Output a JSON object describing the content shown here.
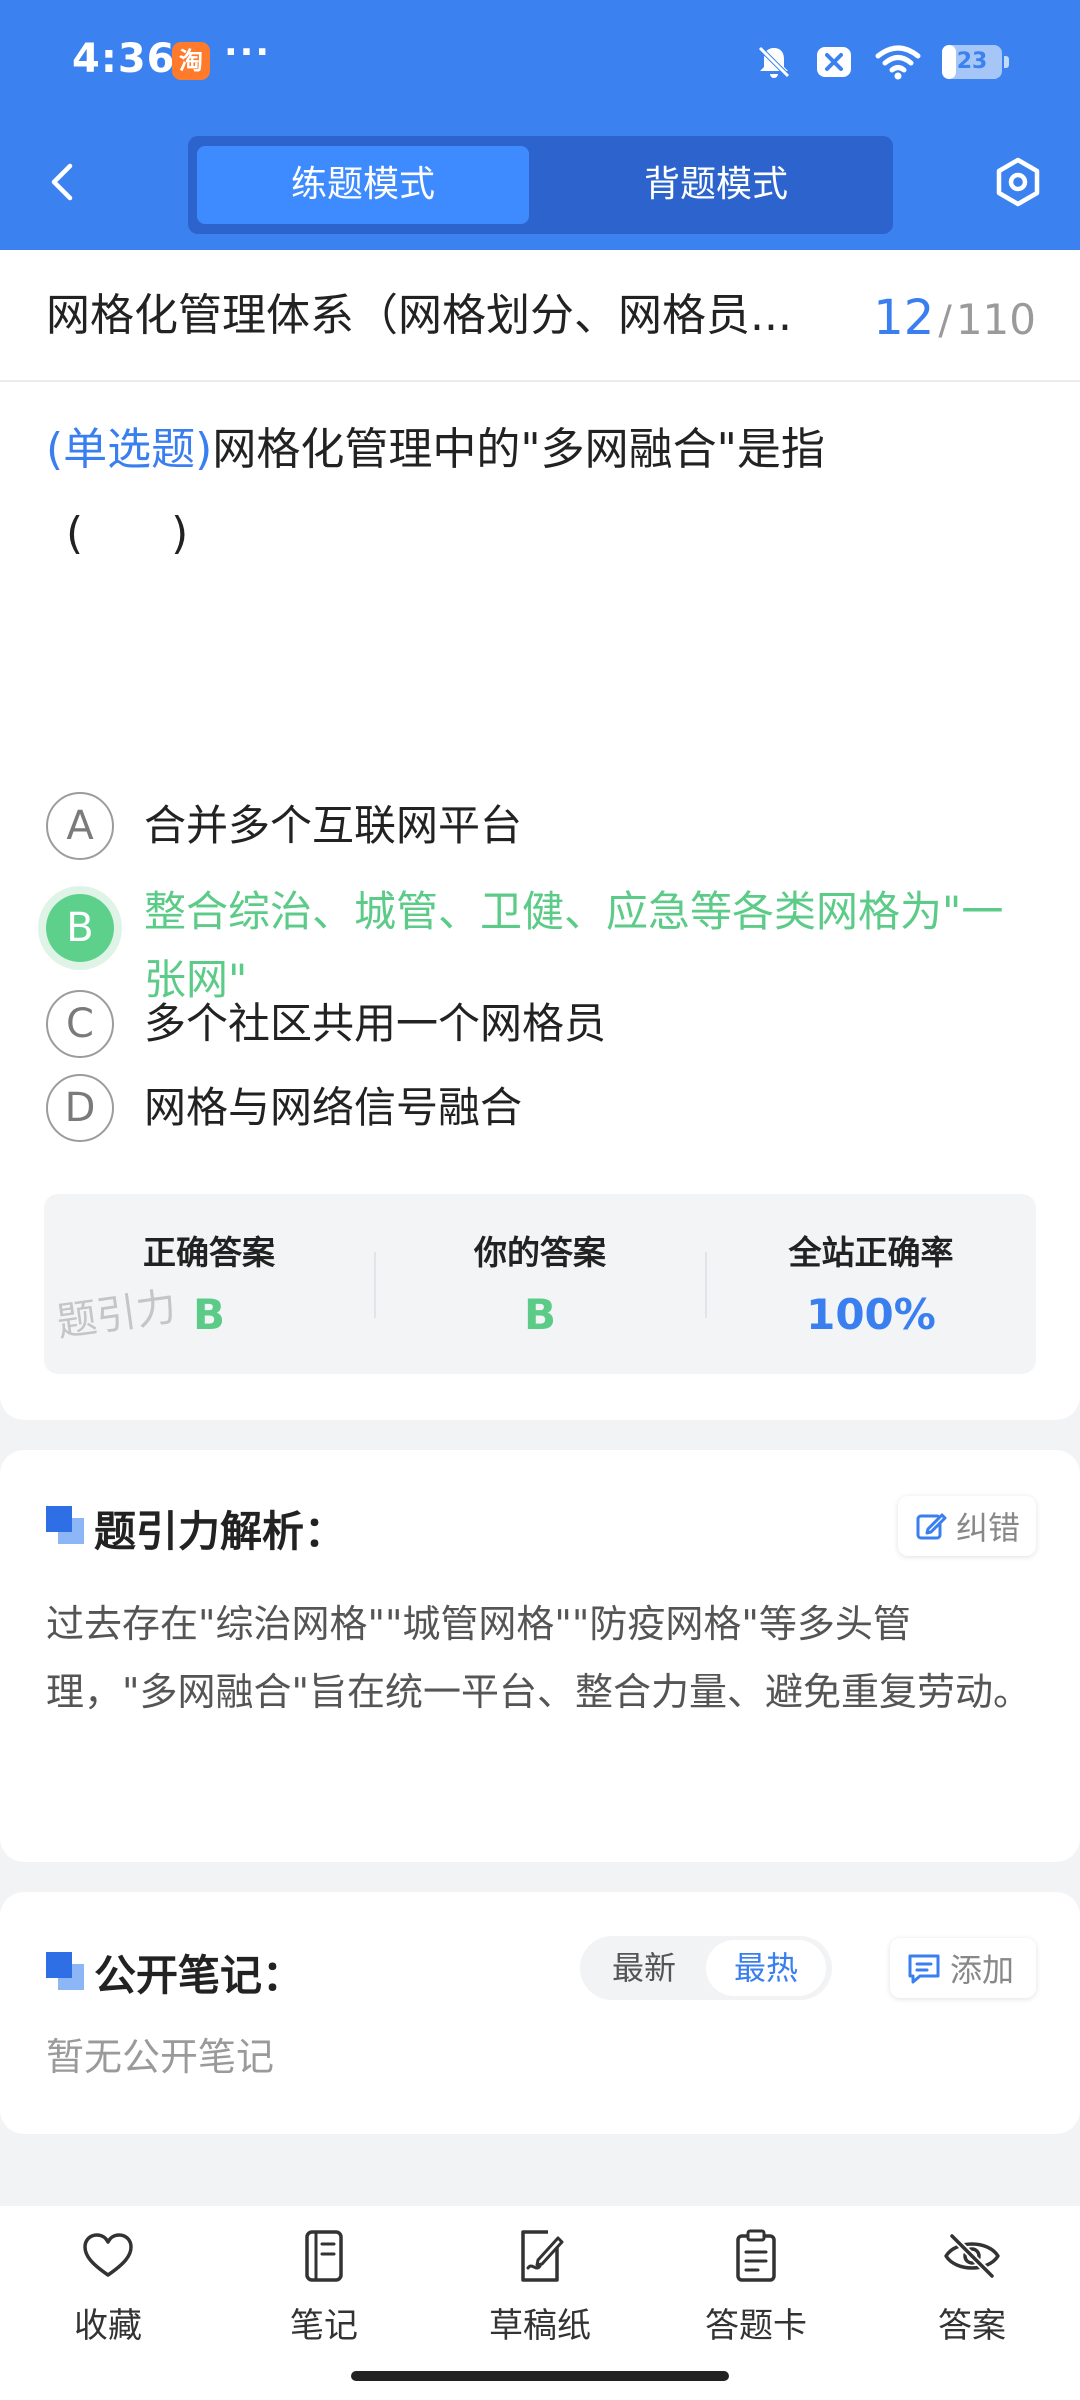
{
  "status_bar": {
    "time": "4:36",
    "app_badge": "淘",
    "more": "···",
    "battery_level": "23",
    "battery_fraction": 0.23
  },
  "header": {
    "modes": [
      "练题模式",
      "背题模式"
    ],
    "active_mode": "练题模式"
  },
  "chapter": {
    "title": "网格化管理体系（网格划分、网格员...",
    "current": "12",
    "separator": "/",
    "total": "110"
  },
  "question": {
    "type": "(单选题)",
    "text": "网格化管理中的\"多网融合\"是指",
    "blank": "(　　)",
    "options": [
      {
        "letter": "A",
        "text": "合并多个互联网平台",
        "state": "normal"
      },
      {
        "letter": "B",
        "text": "整合综治、城管、卫健、应急等各类网格为\"一张网\"",
        "state": "correct"
      },
      {
        "letter": "C",
        "text": "多个社区共用一个网格员",
        "state": "normal"
      },
      {
        "letter": "D",
        "text": "网格与网络信号融合",
        "state": "normal"
      }
    ],
    "result": {
      "correct_label": "正确答案",
      "correct_value": "B",
      "yours_label": "你的答案",
      "yours_value": "B",
      "rate_label": "全站正确率",
      "rate_value": "100%",
      "watermark": "题引力"
    }
  },
  "analysis": {
    "title": "题引力解析：",
    "report_label": "纠错",
    "text": "过去存在\"综治网格\"\"城管网格\"\"防疫网格\"等多头管理，\"多网融合\"旨在统一平台、整合力量、避免重复劳动。"
  },
  "notes": {
    "title": "公开笔记：",
    "sort_options": [
      "最新",
      "最热"
    ],
    "active_sort": "最热",
    "add_label": "添加",
    "empty_text": "暂无公开笔记"
  },
  "bottom_nav": [
    {
      "label": "收藏",
      "icon": "heart-icon"
    },
    {
      "label": "笔记",
      "icon": "notebook-icon"
    },
    {
      "label": "草稿纸",
      "icon": "draft-paper-icon"
    },
    {
      "label": "答题卡",
      "icon": "answer-card-icon"
    },
    {
      "label": "答案",
      "icon": "eye-off-icon"
    }
  ],
  "colors": {
    "primary": "#3b82f0",
    "header_switch_bg": "#2c63cc",
    "active_tab": "#3d8bff",
    "correct_green": "#5dd08c",
    "accent_blue": "#3a7ff0"
  }
}
